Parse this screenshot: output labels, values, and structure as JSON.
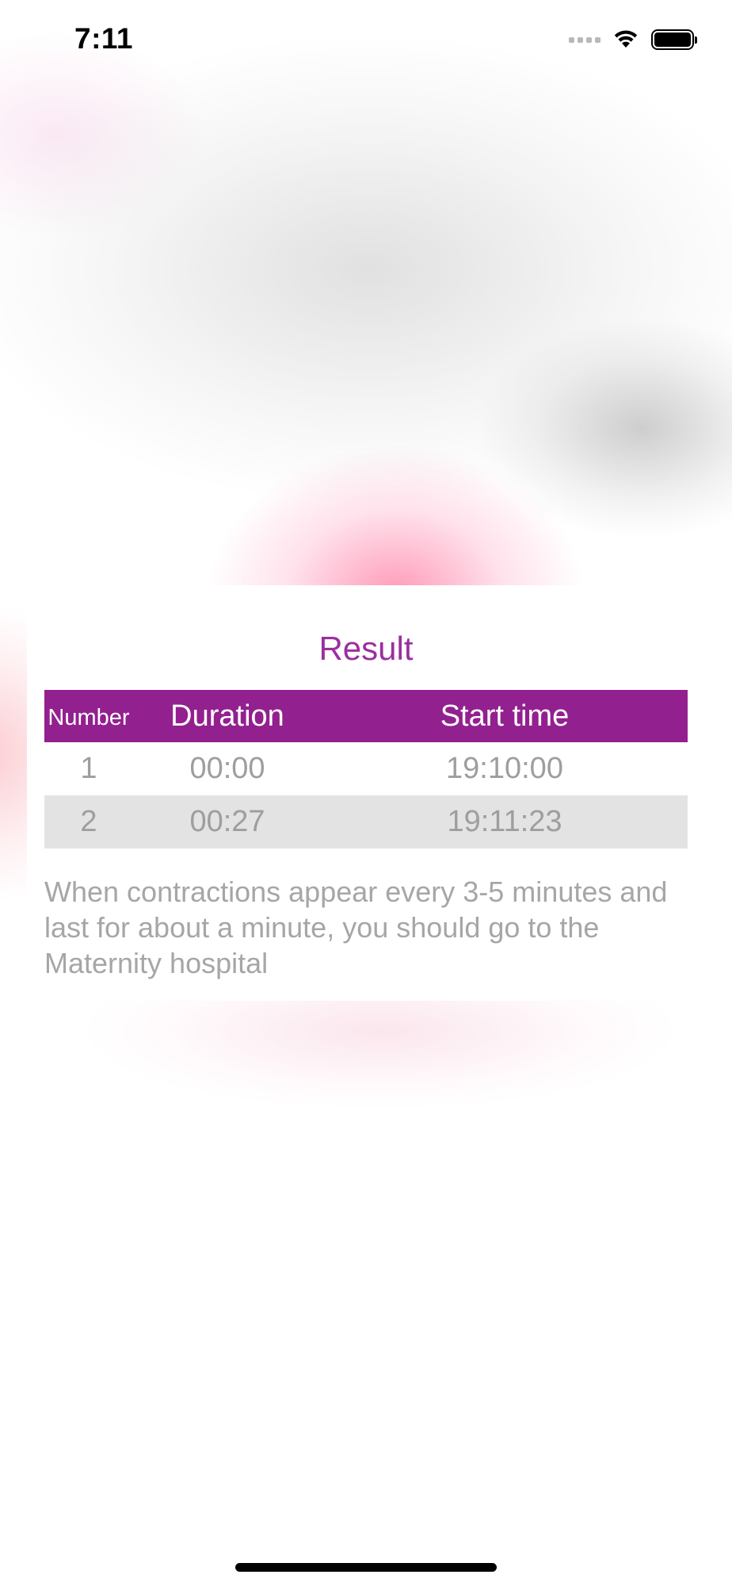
{
  "status_bar": {
    "time": "7:11"
  },
  "card": {
    "title": "Result",
    "table": {
      "headers": {
        "number": "Number",
        "duration": "Duration",
        "start_time": "Start time"
      },
      "rows": [
        {
          "number": "1",
          "duration": "00:00",
          "start_time": "19:10:00"
        },
        {
          "number": "2",
          "duration": "00:27",
          "start_time": "19:11:23"
        }
      ]
    },
    "note": "When contractions appear every 3-5 minutes and last for about a minute, you should go to the Maternity hospital"
  },
  "colors": {
    "accent": "#93208f",
    "title": "#9b2f9e",
    "row_alt": "#e3e3e3",
    "muted_text": "#9e9e9e"
  },
  "icons": {
    "signal": "cellular-signal-icon",
    "wifi": "wifi-icon",
    "battery": "battery-icon"
  }
}
